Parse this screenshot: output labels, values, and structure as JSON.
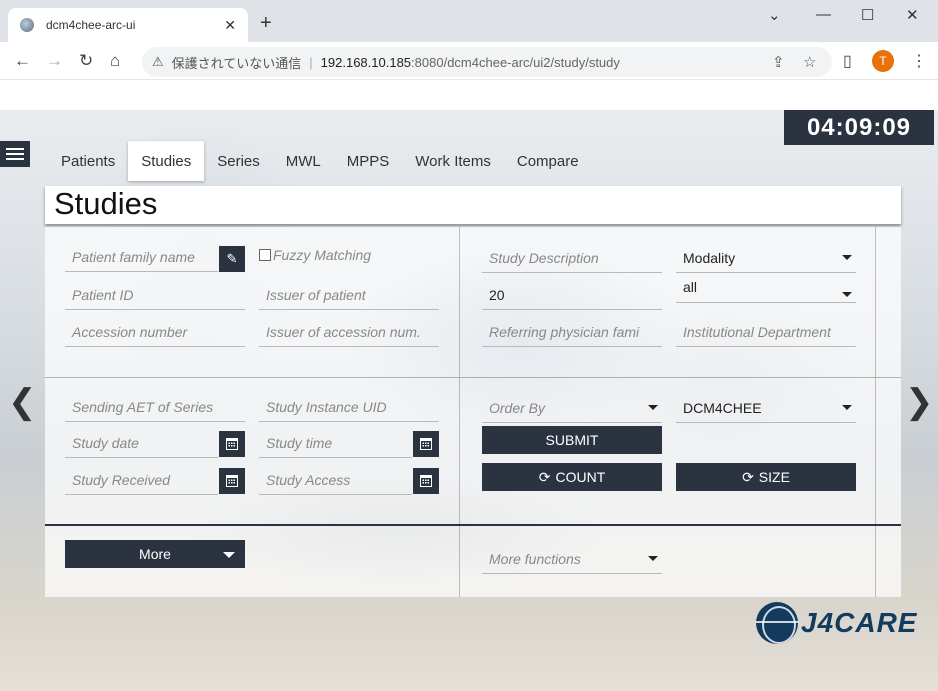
{
  "browser": {
    "tab_title": "dcm4chee-arc-ui",
    "tab_close": "✕",
    "new_tab": "+",
    "minimize": "⌄",
    "address_security": "保護されていない通信",
    "address_host": "192.168.10.185",
    "address_path": ":8080/dcm4chee-arc/ui2/study/study",
    "profile_initial": "T"
  },
  "app": {
    "clock": "04:09:09",
    "nav_tabs": [
      "Patients",
      "Studies",
      "Series",
      "MWL",
      "MPPS",
      "Work Items",
      "Compare"
    ],
    "active_tab": "Studies",
    "page_title": "Studies",
    "filters": {
      "patient_family_name": "Patient family name",
      "fuzzy_matching": "Fuzzy Matching",
      "patient_id": "Patient ID",
      "issuer_of_patient": "Issuer of patient",
      "accession_number": "Accession number",
      "issuer_of_accession": "Issuer of accession num.",
      "study_description": "Study Description",
      "modality": "Modality",
      "limit_value": "20",
      "all_select": "all",
      "referring_physician": "Referring physician fami",
      "institutional_department": "Institutional Department",
      "sending_aet": "Sending AET of Series",
      "study_instance_uid": "Study Instance UID",
      "study_date": "Study date",
      "study_time": "Study time",
      "study_received": "Study Received",
      "study_access": "Study Access",
      "order_by": "Order By",
      "aet_select": "DCM4CHEE"
    },
    "buttons": {
      "submit": "SUBMIT",
      "count": "COUNT",
      "size": "SIZE",
      "more": "More",
      "more_functions": "More functions"
    },
    "logo_text": "J4CARE"
  }
}
